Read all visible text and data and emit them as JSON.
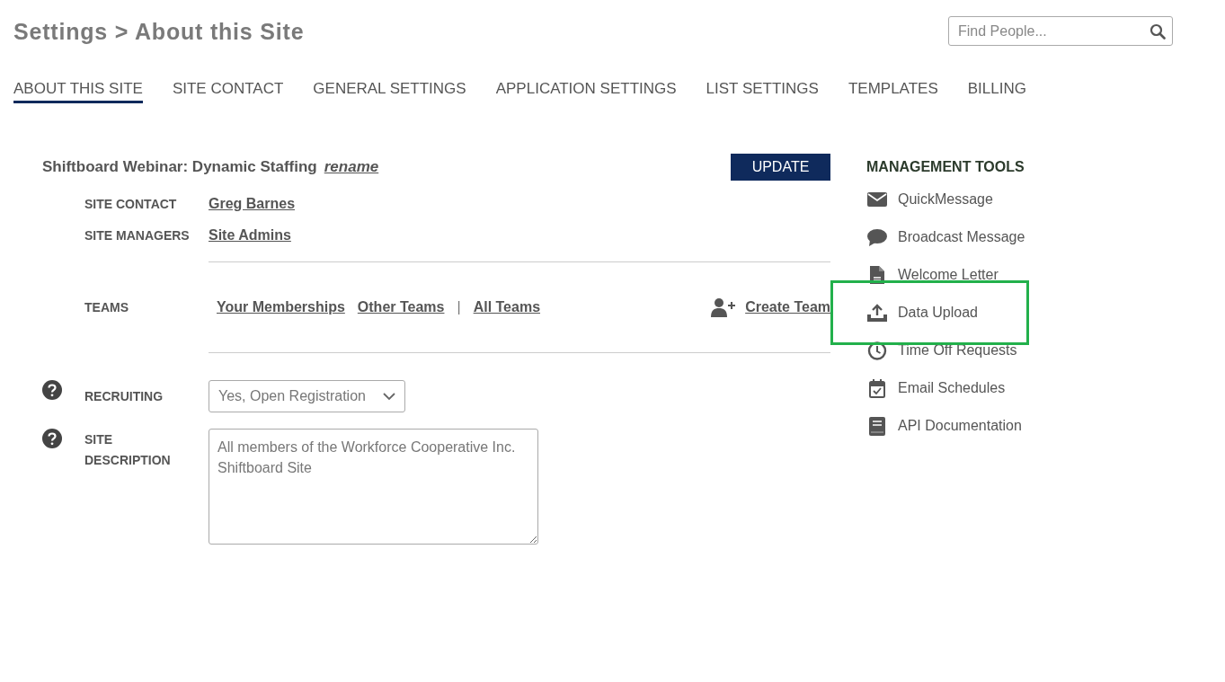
{
  "page_title": "Settings > About this Site",
  "search": {
    "placeholder": "Find People..."
  },
  "tabs": [
    {
      "label": "ABOUT THIS SITE",
      "selected": true
    },
    {
      "label": "SITE CONTACT",
      "selected": false
    },
    {
      "label": "GENERAL SETTINGS",
      "selected": false
    },
    {
      "label": "APPLICATION SETTINGS",
      "selected": false
    },
    {
      "label": "LIST SETTINGS",
      "selected": false
    },
    {
      "label": "TEMPLATES",
      "selected": false
    },
    {
      "label": "BILLING",
      "selected": false
    }
  ],
  "site": {
    "name": "Shiftboard Webinar: Dynamic Staffing",
    "rename_link": "rename",
    "update_button": "UPDATE"
  },
  "site_contact": {
    "label": "SITE CONTACT",
    "value": "Greg Barnes"
  },
  "site_managers": {
    "label": "SITE MANAGERS",
    "value": "Site Admins"
  },
  "teams": {
    "label": "TEAMS",
    "links": [
      "Your Memberships",
      "Other Teams"
    ],
    "separator": "|",
    "all_link": "All Teams",
    "create_link": "Create Team"
  },
  "recruiting": {
    "label": "RECRUITING",
    "value": "Yes, Open Registration"
  },
  "site_description": {
    "label": "SITE DESCRIPTION",
    "value": "All members of the Workforce Cooperative Inc. Shiftboard Site"
  },
  "management_tools": {
    "title": "MANAGEMENT TOOLS",
    "items": [
      {
        "label": "QuickMessage",
        "kind": "envelope",
        "highlighted": false
      },
      {
        "label": "Broadcast Message",
        "kind": "speech",
        "highlighted": false
      },
      {
        "label": "Welcome Letter",
        "kind": "document",
        "highlighted": false
      },
      {
        "label": "Data Upload",
        "kind": "upload",
        "highlighted": true
      },
      {
        "label": "Time Off Requests",
        "kind": "clock",
        "highlighted": false
      },
      {
        "label": "Email Schedules",
        "kind": "calendar",
        "highlighted": false
      },
      {
        "label": "API Documentation",
        "kind": "book",
        "highlighted": false
      }
    ]
  }
}
